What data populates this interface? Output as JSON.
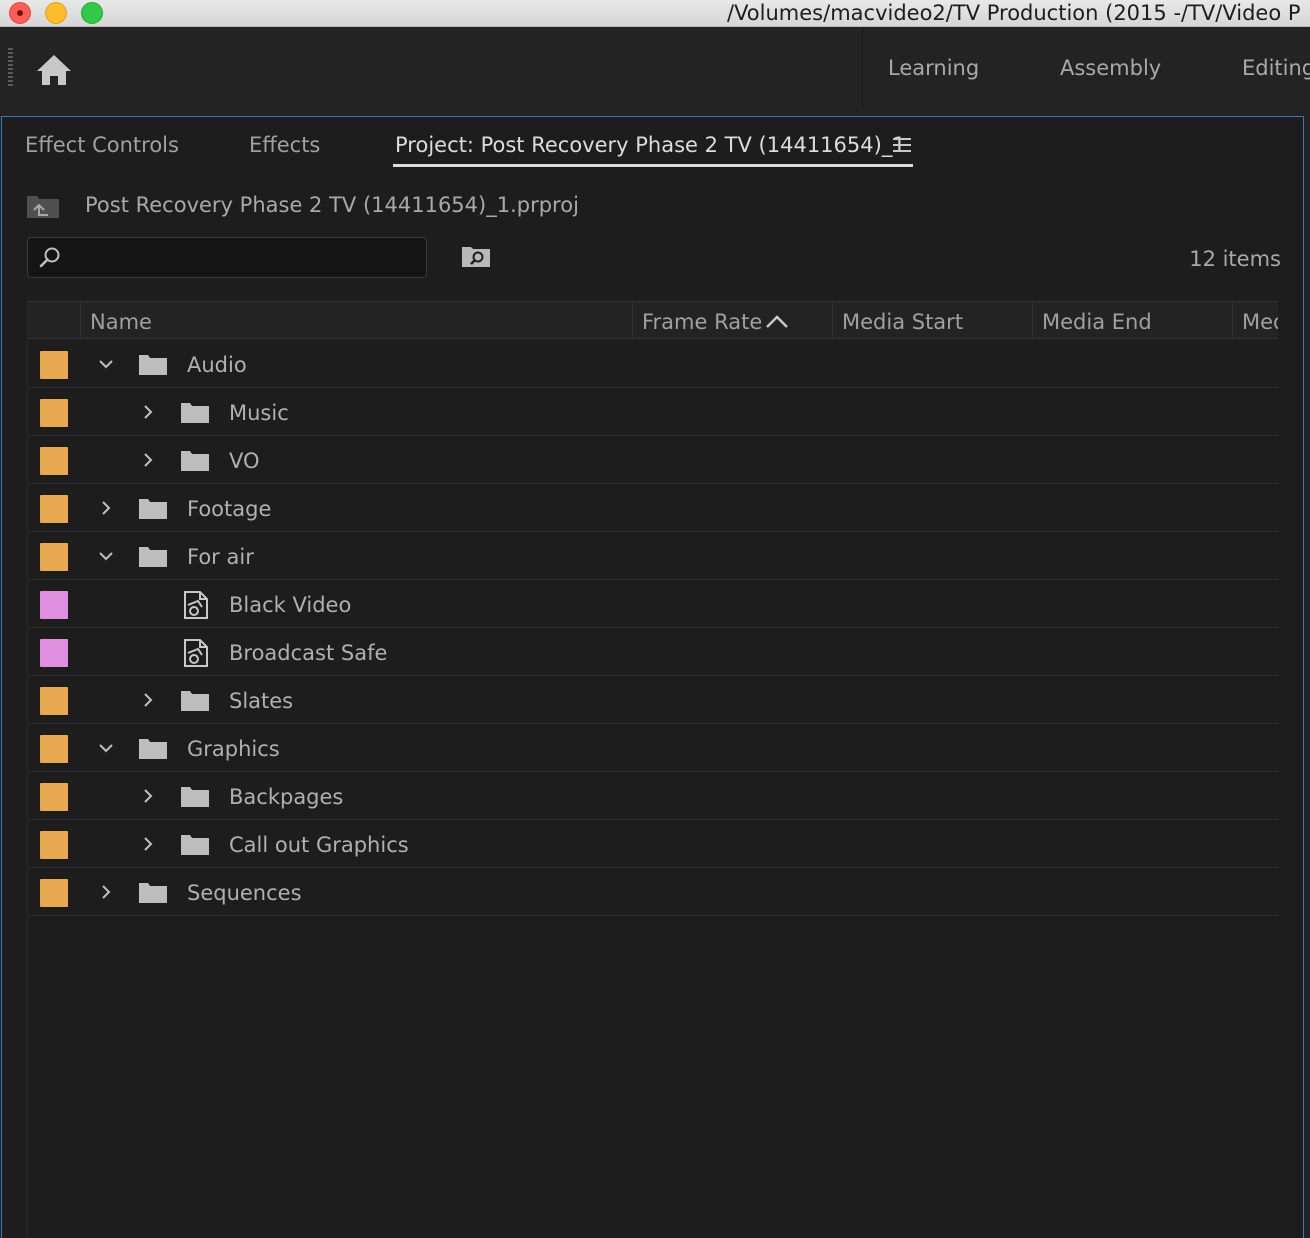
{
  "window": {
    "title": "/Volumes/macvideo2/TV Production (2015 -/TV/Video P"
  },
  "workspaces": [
    "Learning",
    "Assembly",
    "Editing"
  ],
  "panel_tabs": [
    "Effect Controls",
    "Effects",
    "Project: Post Recovery Phase 2 TV (14411654)_1"
  ],
  "project": {
    "file_name": "Post Recovery Phase 2 TV (14411654)_1.prproj",
    "search_value": "",
    "item_count": "12 items"
  },
  "columns": [
    "Name",
    "Frame Rate",
    "Media Start",
    "Media End",
    "Med"
  ],
  "sort": {
    "column": "Frame Rate",
    "direction": "ascending"
  },
  "colors": {
    "label_orange": "#e8a850",
    "label_pink": "#e08ee0",
    "accent_blue": "#3d77b8"
  },
  "rows": [
    {
      "name": "Audio",
      "type": "folder",
      "depth": 0,
      "state": "expanded",
      "label": "orange"
    },
    {
      "name": "Music",
      "type": "folder",
      "depth": 1,
      "state": "collapsed",
      "label": "orange"
    },
    {
      "name": "VO",
      "type": "folder",
      "depth": 1,
      "state": "collapsed",
      "label": "orange"
    },
    {
      "name": "Footage",
      "type": "folder",
      "depth": 0,
      "state": "collapsed",
      "label": "orange"
    },
    {
      "name": "For air",
      "type": "folder",
      "depth": 0,
      "state": "expanded",
      "label": "orange"
    },
    {
      "name": "Black Video",
      "type": "effect-preset",
      "depth": 1,
      "state": "none",
      "label": "pink"
    },
    {
      "name": "Broadcast Safe",
      "type": "effect-preset",
      "depth": 1,
      "state": "none",
      "label": "pink"
    },
    {
      "name": "Slates",
      "type": "folder",
      "depth": 1,
      "state": "collapsed",
      "label": "orange"
    },
    {
      "name": "Graphics",
      "type": "folder",
      "depth": 0,
      "state": "expanded",
      "label": "orange"
    },
    {
      "name": "Backpages",
      "type": "folder",
      "depth": 1,
      "state": "collapsed",
      "label": "orange"
    },
    {
      "name": "Call out Graphics",
      "type": "folder",
      "depth": 1,
      "state": "collapsed",
      "label": "orange"
    },
    {
      "name": "Sequences",
      "type": "folder",
      "depth": 0,
      "state": "collapsed",
      "label": "orange"
    }
  ]
}
